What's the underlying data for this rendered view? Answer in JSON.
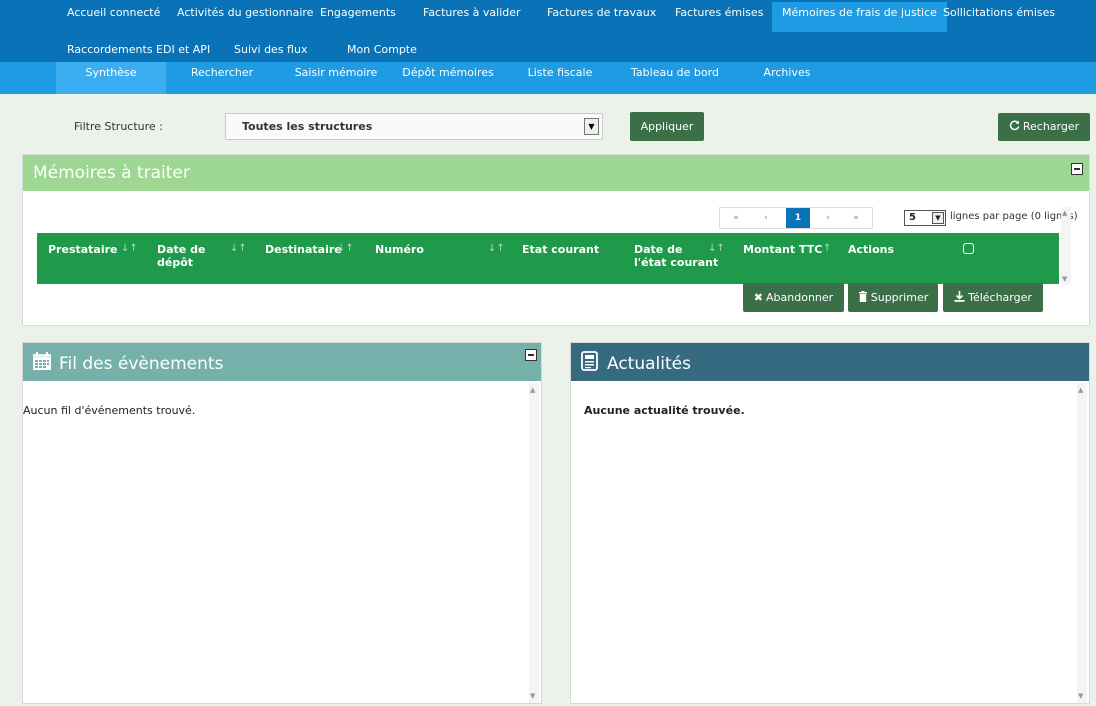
{
  "top_nav": [
    {
      "label": "Accueil connecté",
      "active": false
    },
    {
      "label": "Activités du gestionnaire",
      "active": false
    },
    {
      "label": "Engagements",
      "active": false
    },
    {
      "label": "Factures à valider",
      "active": false
    },
    {
      "label": "Factures de travaux",
      "active": false
    },
    {
      "label": "Factures émises",
      "active": false
    },
    {
      "label": "Mémoires de frais de justice",
      "active": true
    },
    {
      "label": "Sollicitations émises",
      "active": false
    },
    {
      "label": "Raccordements EDI et API",
      "active": false
    },
    {
      "label": "Suivi des flux",
      "active": false
    },
    {
      "label": "Mon Compte",
      "active": false
    }
  ],
  "sub_nav": [
    {
      "label": "Synthèse",
      "active": true
    },
    {
      "label": "Rechercher",
      "active": false
    },
    {
      "label": "Saisir mémoire",
      "active": false
    },
    {
      "label": "Dépôt mémoires",
      "active": false
    },
    {
      "label": "Liste fiscale",
      "active": false
    },
    {
      "label": "Tableau de bord",
      "active": false
    },
    {
      "label": "Archives",
      "active": false
    }
  ],
  "filter": {
    "label": "Filtre Structure :",
    "selected": "Toutes les structures",
    "apply_label": "Appliquer",
    "reload_label": "Recharger"
  },
  "memoires": {
    "title": "Mémoires à traiter",
    "pager": {
      "first": "«",
      "prev": "‹",
      "current": "1",
      "next": "›",
      "last": "»"
    },
    "rows_per_page": "5",
    "rows_label": "lignes par page (0 lignes)",
    "columns": [
      {
        "l1": "Prestataire",
        "l2": ""
      },
      {
        "l1": "Date de",
        "l2": "dépôt"
      },
      {
        "l1": "Destinataire",
        "l2": ""
      },
      {
        "l1": "Numéro",
        "l2": ""
      },
      {
        "l1": "Etat courant",
        "l2": ""
      },
      {
        "l1": "Date de",
        "l2": "l'état courant"
      },
      {
        "l1": "Montant TTC",
        "l2": ""
      },
      {
        "l1": "Actions",
        "l2": ""
      }
    ],
    "buttons": {
      "abandon": "Abandonner",
      "delete": "Supprimer",
      "download": "Télécharger"
    }
  },
  "fil": {
    "title": "Fil des évènements",
    "empty": "Aucun fil d'événements trouvé."
  },
  "actualites": {
    "title": "Actualités",
    "empty": "Aucune actualité trouvée."
  },
  "colors": {
    "top_nav": "#0a72b6",
    "sub_nav": "#1e9be2",
    "memoires_header": "#9ed694",
    "table_header": "#1e9a4a",
    "button": "#3a6f48",
    "fil_header": "#76b0aa",
    "actualites_header": "#366a80"
  }
}
